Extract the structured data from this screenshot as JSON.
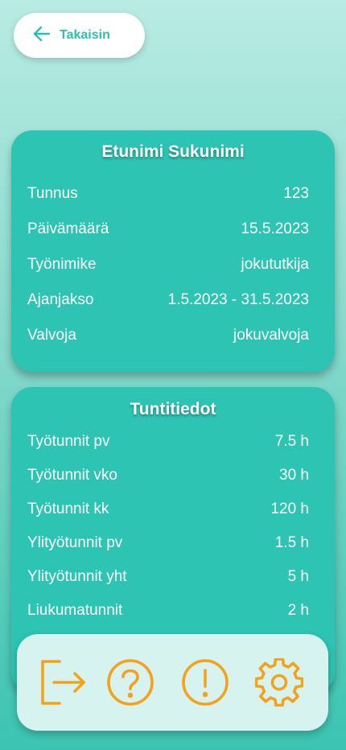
{
  "back": {
    "label": "Takaisin",
    "icon": "arrow-left-icon"
  },
  "profile": {
    "name": "Etunimi Sukunimi",
    "rows": [
      {
        "label": "Tunnus",
        "value": "123"
      },
      {
        "label": "Päivämäärä",
        "value": "15.5.2023"
      },
      {
        "label": "Työnimike",
        "value": "jokututkija"
      },
      {
        "label": "Ajanjakso",
        "value": "1.5.2023 - 31.5.2023"
      },
      {
        "label": "Valvoja",
        "value": "jokuvalvoja"
      }
    ]
  },
  "hours": {
    "title": "Tuntitiedot",
    "rows": [
      {
        "label": "Työtunnit pv",
        "value": "7.5 h"
      },
      {
        "label": "Työtunnit vko",
        "value": "30 h"
      },
      {
        "label": "Työtunnit kk",
        "value": "120 h"
      },
      {
        "label": "Ylityötunnit pv",
        "value": "1.5 h"
      },
      {
        "label": "Ylityötunnit yht",
        "value": "5 h"
      },
      {
        "label": "Liukumatunnit",
        "value": "2 h"
      }
    ]
  },
  "bottom_nav": {
    "items": [
      {
        "icon": "logout-icon"
      },
      {
        "icon": "help-icon"
      },
      {
        "icon": "alert-icon"
      },
      {
        "icon": "settings-gear-icon"
      }
    ]
  },
  "colors": {
    "accent": "#2cc0ad",
    "card": "#2ec4b4",
    "icon_orange": "#f5a21b",
    "bar_bg": "#d7f3f0"
  }
}
